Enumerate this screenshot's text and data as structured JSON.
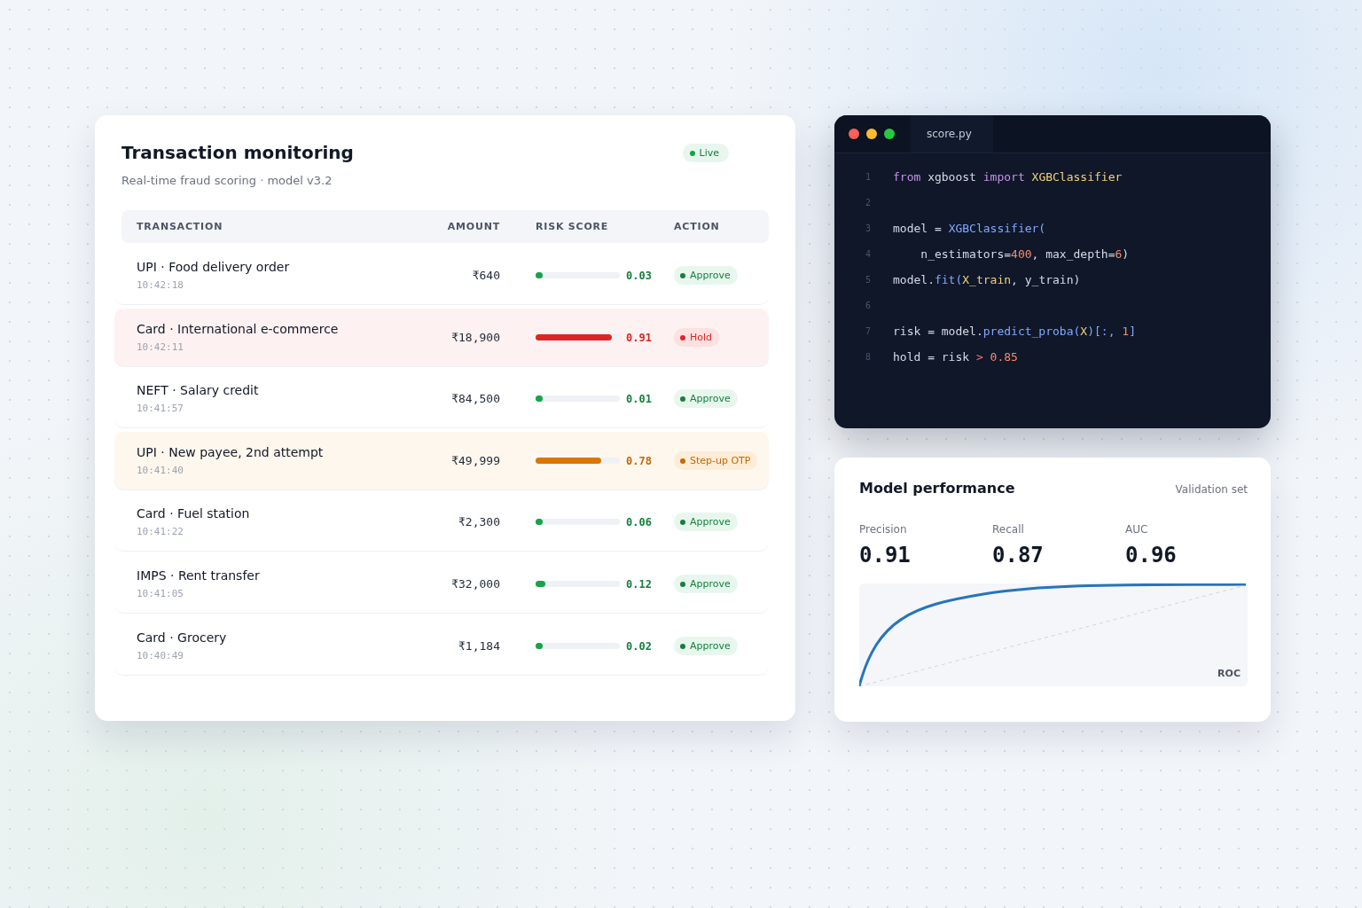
{
  "monitor": {
    "title": "Transaction monitoring",
    "subtitle": "Real-time fraud scoring · model v3.2",
    "status": "Live",
    "columns": [
      "TRANSACTION",
      "AMOUNT",
      "RISK SCORE",
      "ACTION"
    ],
    "rows": [
      {
        "kind": "approve",
        "name": "UPI · Food delivery order",
        "time": "10:42:18",
        "amount": "₹640",
        "level": 0.03,
        "score": "0.03",
        "action": "Approve"
      },
      {
        "kind": "hold",
        "name": "Card · International e-commerce",
        "time": "10:42:11",
        "amount": "₹18,900",
        "level": 0.91,
        "score": "0.91",
        "action": "Hold"
      },
      {
        "kind": "approve",
        "name": "NEFT · Salary credit",
        "time": "10:41:57",
        "amount": "₹84,500",
        "level": 0.01,
        "score": "0.01",
        "action": "Approve"
      },
      {
        "kind": "stepup",
        "name": "UPI · New payee, 2nd attempt",
        "time": "10:41:40",
        "amount": "₹49,999",
        "level": 0.78,
        "score": "0.78",
        "action": "Step-up OTP"
      },
      {
        "kind": "approve",
        "name": "Card · Fuel station",
        "time": "10:41:22",
        "amount": "₹2,300",
        "level": 0.06,
        "score": "0.06",
        "action": "Approve"
      },
      {
        "kind": "approve",
        "name": "IMPS · Rent transfer",
        "time": "10:41:05",
        "amount": "₹32,000",
        "level": 0.12,
        "score": "0.12",
        "action": "Approve"
      },
      {
        "kind": "approve",
        "name": "Card · Grocery",
        "time": "10:40:49",
        "amount": "₹1,184",
        "level": 0.02,
        "score": "0.02",
        "action": "Approve"
      }
    ]
  },
  "editor": {
    "tab": "score.py",
    "lines": [
      {
        "number": "1",
        "tokens": [
          {
            "kind": "kw",
            "text": "from"
          },
          {
            "kind": "plain",
            "text": " xgboost "
          },
          {
            "kind": "kw",
            "text": "import"
          },
          {
            "kind": "cls",
            "text": " XGBClassifier"
          }
        ]
      },
      {
        "number": "2"
      },
      {
        "number": "3",
        "tokens": [
          {
            "kind": "plain",
            "text": "model = "
          },
          {
            "kind": "fn",
            "text": "XGBClassifier("
          }
        ]
      },
      {
        "number": "4",
        "tokens": [
          {
            "kind": "plain",
            "text": "    n_estimators="
          },
          {
            "kind": "num",
            "text": "400"
          },
          {
            "kind": "plain",
            "text": ", max_depth="
          },
          {
            "kind": "num",
            "text": "6"
          },
          {
            "kind": "plain",
            "text": ")"
          }
        ]
      },
      {
        "number": "5",
        "tokens": [
          {
            "kind": "plain",
            "text": "model."
          },
          {
            "kind": "fn",
            "text": "fit("
          },
          {
            "kind": "cls",
            "text": "X_train"
          },
          {
            "kind": "plain",
            "text": ", y_train)"
          }
        ]
      },
      {
        "number": "6"
      },
      {
        "number": "7",
        "tokens": [
          {
            "kind": "plain",
            "text": "risk = model."
          },
          {
            "kind": "fn",
            "text": "predict_proba("
          },
          {
            "kind": "cls",
            "text": "X"
          },
          {
            "kind": "fn",
            "text": ")[:, "
          },
          {
            "kind": "num",
            "text": "1"
          },
          {
            "kind": "fn",
            "text": "]"
          }
        ]
      },
      {
        "number": "8",
        "tokens": [
          {
            "kind": "plain",
            "text": "hold = risk "
          },
          {
            "kind": "op",
            "text": ">"
          },
          {
            "kind": "num",
            "text": " 0.85"
          }
        ]
      }
    ]
  },
  "performance": {
    "title": "Model performance",
    "subtitle": "Validation set",
    "metrics": [
      {
        "label": "Precision",
        "value": "0.91"
      },
      {
        "label": "Recall",
        "value": "0.87"
      },
      {
        "label": "AUC",
        "value": "0.96"
      }
    ],
    "curve_label": "ROC"
  }
}
